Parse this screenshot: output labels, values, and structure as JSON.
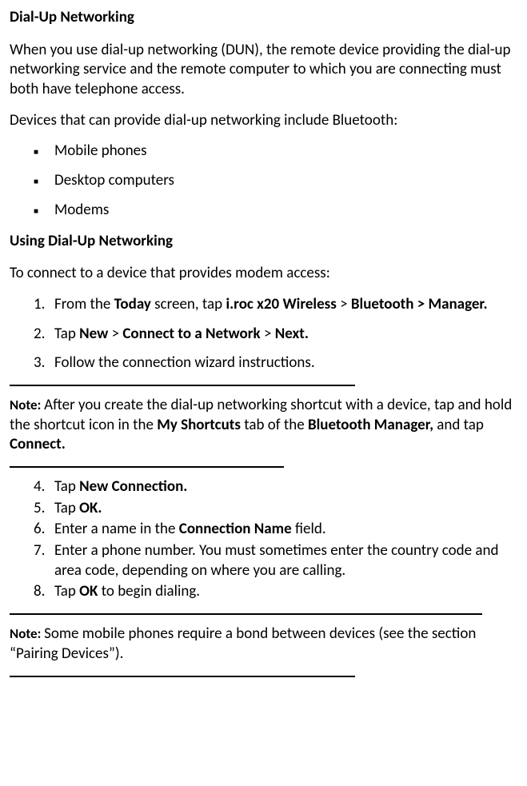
{
  "section1": {
    "heading": "Dial-Up Networking",
    "intro": "When you use dial-up networking (DUN), the remote device providing the dial-up networking service and the remote computer to which you are connecting must both have telephone access.",
    "devices_intro": "Devices that can provide dial-up networking include Bluetooth:",
    "devices": [
      "Mobile phones",
      "Desktop computers",
      "Modems"
    ]
  },
  "section2": {
    "heading": "Using Dial-Up Networking",
    "intro": "To connect to a device that provides modem access:",
    "steps_a": [
      {
        "pre": "From the ",
        "b1": "Today",
        "mid1": " screen, tap ",
        "b2": "i.roc x20 Wireless",
        "mid2": " > ",
        "b3": "Bluetooth > Manager."
      },
      {
        "pre": "Tap ",
        "b1": "New",
        "mid1": " > ",
        "b2": "Connect to a Network",
        "mid2": " > ",
        "b3": "Next."
      },
      {
        "pre": "Follow the connection wizard instructions."
      }
    ],
    "note1": {
      "label": "Note: ",
      "t1": "After you create the dial-up networking shortcut with a device, tap and hold the shortcut icon in the ",
      "b1": "My Shortcuts",
      "t2": " tab of the ",
      "b2": "Bluetooth Manager,",
      "t3": " and tap ",
      "b3": "Connect."
    },
    "steps_b": [
      {
        "pre": "Tap ",
        "b1": "New Connection."
      },
      {
        "pre": "Tap ",
        "b1": "OK."
      },
      {
        "pre": "Enter a name in the ",
        "b1": "Connection Name",
        "post": " field."
      },
      {
        "pre": "Enter a phone number. You must sometimes enter the country code and area code, depending on where you are calling."
      },
      {
        "pre": "Tap ",
        "b1": "OK",
        "post": " to begin dialing."
      }
    ],
    "note2": {
      "label": "Note: ",
      "t1": "Some mobile phones require a bond between devices (see the section “Pairing Devices”)."
    }
  }
}
